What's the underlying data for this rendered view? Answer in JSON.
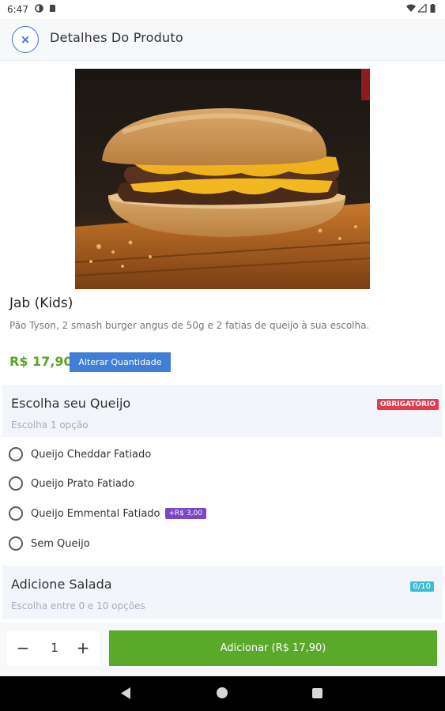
{
  "status_bar": {
    "time": "6:47",
    "left_icons": [
      "circle-half-icon",
      "sd-card-icon"
    ],
    "right_icons": [
      "wifi-icon",
      "signal-icon",
      "battery-icon"
    ]
  },
  "header": {
    "close_icon": "×",
    "title": "Detalhes Do Produto"
  },
  "product": {
    "image_alt": "hamburger-image",
    "name": "Jab (Kids)",
    "description": "Pão Tyson, 2 smash burger angus de 50g e 2 fatias de queijo à sua escolha.",
    "price": "R$ 17,90",
    "change_quantity_label": "Alterar Quantidade"
  },
  "sections": [
    {
      "title": "Escolha seu Queijo",
      "subtitle": "Escolha 1 opção",
      "badge": "OBRIGATÓRIO",
      "options": [
        {
          "label": "Queijo Cheddar Fatiado",
          "extra": ""
        },
        {
          "label": "Queijo Prato Fatiado",
          "extra": ""
        },
        {
          "label": "Queijo Emmental Fatiado",
          "extra": "+R$ 3,00"
        },
        {
          "label": "Sem Queijo",
          "extra": ""
        }
      ]
    },
    {
      "title": "Adicione Salada",
      "subtitle": "Escolha entre 0 e 10 opções",
      "badge": "0/10"
    }
  ],
  "bottom_bar": {
    "minus": "−",
    "quantity": "1",
    "plus": "+",
    "add_label": "Adicionar (R$ 17,90)"
  },
  "colors": {
    "accent_blue": "#3f7fd6",
    "price_green": "#5aa32b",
    "add_button_green": "#5aa92b",
    "required_red": "#e53b4f",
    "extra_purple": "#7a47c7",
    "count_teal": "#3dbcd6"
  }
}
